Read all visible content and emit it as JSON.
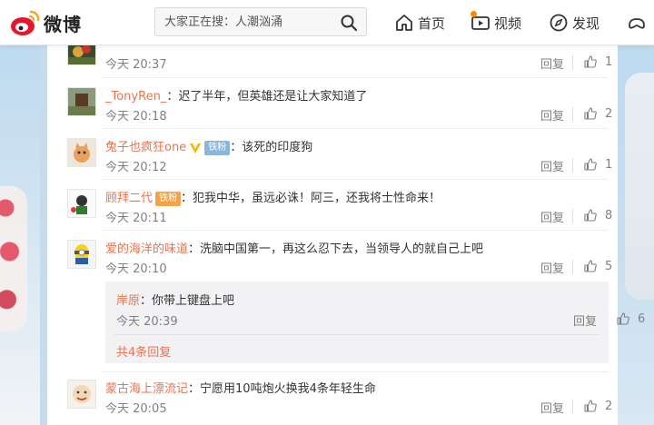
{
  "header": {
    "brand": "微博",
    "search": {
      "placeholder": "大家正在搜：人潮汹涌",
      "value": ""
    },
    "nav": [
      {
        "label": "首页",
        "icon": "home-icon"
      },
      {
        "label": "视频",
        "icon": "video-icon"
      },
      {
        "label": "发现",
        "icon": "compass-icon"
      }
    ]
  },
  "comments": [
    {
      "user": "",
      "text": "",
      "time": "今天 20:37",
      "reply": "回复",
      "likes": "1"
    },
    {
      "user": "_TonyRen_",
      "text": "迟了半年，但英雄还是让大家知道了",
      "time": "今天 20:18",
      "reply": "回复",
      "likes": "2"
    },
    {
      "user": "兔子也疯狂one",
      "badge": "铁粉",
      "text": "该死的印度狗",
      "time": "今天 20:12",
      "reply": "回复",
      "likes": "1"
    },
    {
      "user": "顾拜二代",
      "badge": "铁粉",
      "text": "犯我中华，虽远必诛！阿三，还我将士性命来！",
      "time": "今天 20:11",
      "reply": "回复",
      "likes": "8"
    },
    {
      "user": "爱的海洋的味道",
      "text": "洗脑中国第一，再这么忍下去，当领导人的就自己上吧",
      "time": "今天 20:10",
      "reply": "回复",
      "likes": "5"
    },
    {
      "user": "蒙古海上漂流记",
      "text": "宁愿用10吨炮火换我4条年轻生命",
      "time": "今天 20:05",
      "reply": "回复",
      "likes": "2"
    }
  ],
  "sub_reply": {
    "user": "岸原",
    "text": "你带上键盘上吧",
    "time": "今天 20:39",
    "reply": "回复",
    "likes": "6",
    "more": "共4条回复"
  },
  "colors": {
    "accent": "#eb7350",
    "meta": "#808080",
    "fan_badge": "#8ab6dc"
  }
}
